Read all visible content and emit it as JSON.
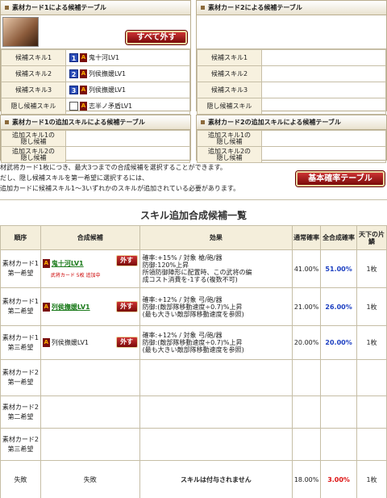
{
  "card1": {
    "title": "素材カード1による候補テーブル",
    "remove_all_label": "すべて外す",
    "rows": [
      {
        "label": "候補スキル1",
        "num": "1",
        "skill": "鬼十河LV1"
      },
      {
        "label": "候補スキル2",
        "num": "2",
        "skill": "列侯撫媛LV1"
      },
      {
        "label": "候補スキル3",
        "num": "3",
        "skill": "列侯撫媛LV1"
      },
      {
        "label": "隠し候補スキル",
        "num": "",
        "skill": "志半ノ矛盾LV1"
      }
    ]
  },
  "card2": {
    "title": "素材カード2による候補テーブル",
    "rows": [
      {
        "label": "候補スキル1"
      },
      {
        "label": "候補スキル2"
      },
      {
        "label": "候補スキル3"
      },
      {
        "label": "隠し候補スキル"
      }
    ]
  },
  "card1_extra": {
    "title": "素材カード1の追加スキルによる候補テーブル",
    "rows": [
      {
        "label1": "追加スキル1の",
        "label2": "隠し候補"
      },
      {
        "label1": "追加スキル2の",
        "label2": "隠し候補"
      }
    ]
  },
  "card2_extra": {
    "title": "素材カード2の追加スキルによる候補テーブル",
    "rows": [
      {
        "label1": "追加スキル1の",
        "label2": "隠し候補"
      },
      {
        "label1": "追加スキル2の",
        "label2": "隠し候補"
      }
    ]
  },
  "notes": [
    "材武将カード1枚につき、最大3つまでの合成候補を選択することができます。",
    "だし、隠し候補スキルを第一希望に選択するには、",
    "追加カードに候補スキル1～3いずれかのスキルが追加されている必要があります。"
  ],
  "base_rate_button": "基本確率テーブル",
  "section_title": "スキル追加合成候補一覧",
  "columns": [
    "順序",
    "合成候補",
    "効果",
    "通常確率",
    "全合成確率",
    "天下の片鱗"
  ],
  "rows": [
    {
      "order1": "素材カード1",
      "order2": "第一希望",
      "skill": "鬼十河LV1",
      "skill_style": "green",
      "remove": "外す",
      "sub": "武将カード 5枚 追加中",
      "eff": [
        "確率:+15% / 対象 槍/砲/器",
        "防御:120%上昇",
        "所領防御陣形に配置時、この武将の編",
        "成コスト消費を-1する(複数不可)"
      ],
      "normal": "41.00%",
      "total": "51.00%",
      "total_style": "blue",
      "piece": "1枚"
    },
    {
      "order1": "素材カード1",
      "order2": "第二希望",
      "skill": "列侯撫媛LV1",
      "skill_style": "green",
      "remove": "外す",
      "sub": "",
      "eff": [
        "確率:+12% / 対象 弓/砲/器",
        "防御:(敵部隊移動速度÷0.7)%上昇",
        "(最も大きい敵部隊移動速度を参照)"
      ],
      "normal": "21.00%",
      "total": "26.00%",
      "total_style": "blue",
      "piece": "1枚"
    },
    {
      "order1": "素材カード1",
      "order2": "第三希望",
      "skill": "列侯撫媛LV1",
      "skill_style": "plain",
      "remove": "外す",
      "sub": "",
      "eff": [
        "確率:+12% / 対象 弓/砲/器",
        "防御:(敵部隊移動速度÷0.7)%上昇",
        "(最も大きい敵部隊移動速度を参照)"
      ],
      "normal": "20.00%",
      "total": "20.00%",
      "total_style": "blue",
      "piece": "1枚"
    },
    {
      "order1": "素材カード2",
      "order2": "第一希望",
      "skill": "",
      "remove": "",
      "sub": "",
      "eff": [],
      "normal": "",
      "total": "",
      "piece": ""
    },
    {
      "order1": "素材カード2",
      "order2": "第二希望",
      "skill": "",
      "remove": "",
      "sub": "",
      "eff": [],
      "normal": "",
      "total": "",
      "piece": ""
    },
    {
      "order1": "素材カード2",
      "order2": "第三希望",
      "skill": "",
      "remove": "",
      "sub": "",
      "eff": [],
      "normal": "",
      "total": "",
      "piece": ""
    }
  ],
  "fail_row": {
    "order": "失敗",
    "skill": "失敗",
    "eff": "スキルは付与されません",
    "normal": "18.00%",
    "total": "3.00%",
    "piece": "1枚"
  }
}
